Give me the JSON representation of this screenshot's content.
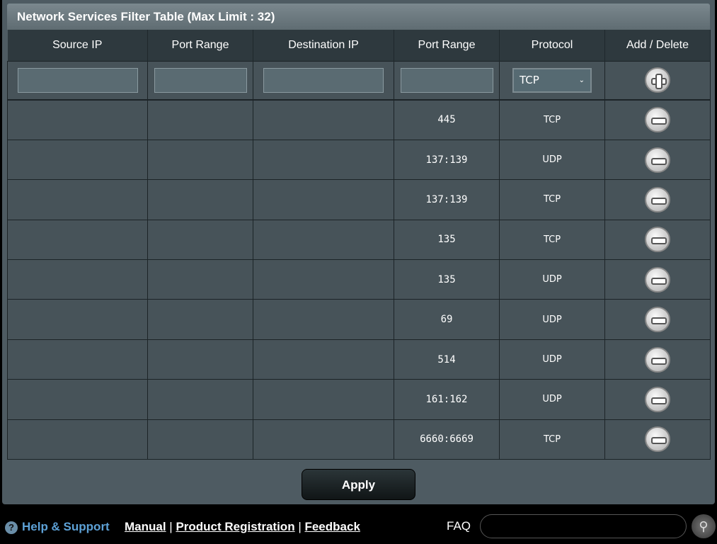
{
  "title": "Network Services Filter Table (Max Limit : 32)",
  "columns": [
    "Source IP",
    "Port Range",
    "Destination IP",
    "Port Range",
    "Protocol",
    "Add / Delete"
  ],
  "input_row": {
    "source_ip": "",
    "src_port": "",
    "dest_ip": "",
    "dst_port": "",
    "protocol": "TCP"
  },
  "rows": [
    {
      "source_ip": "",
      "src_port": "",
      "dest_ip": "",
      "dst_port": "445",
      "protocol": "TCP"
    },
    {
      "source_ip": "",
      "src_port": "",
      "dest_ip": "",
      "dst_port": "137:139",
      "protocol": "UDP"
    },
    {
      "source_ip": "",
      "src_port": "",
      "dest_ip": "",
      "dst_port": "137:139",
      "protocol": "TCP"
    },
    {
      "source_ip": "",
      "src_port": "",
      "dest_ip": "",
      "dst_port": "135",
      "protocol": "TCP"
    },
    {
      "source_ip": "",
      "src_port": "",
      "dest_ip": "",
      "dst_port": "135",
      "protocol": "UDP"
    },
    {
      "source_ip": "",
      "src_port": "",
      "dest_ip": "",
      "dst_port": "69",
      "protocol": "UDP"
    },
    {
      "source_ip": "",
      "src_port": "",
      "dest_ip": "",
      "dst_port": "514",
      "protocol": "UDP"
    },
    {
      "source_ip": "",
      "src_port": "",
      "dest_ip": "",
      "dst_port": "161:162",
      "protocol": "UDP"
    },
    {
      "source_ip": "",
      "src_port": "",
      "dest_ip": "",
      "dst_port": "6660:6669",
      "protocol": "TCP"
    }
  ],
  "apply_label": "Apply",
  "footer": {
    "help": "Help & Support",
    "manual": "Manual",
    "sep": "|",
    "registration": "Product Registration",
    "feedback": "Feedback",
    "faq": "FAQ",
    "faq_value": ""
  }
}
